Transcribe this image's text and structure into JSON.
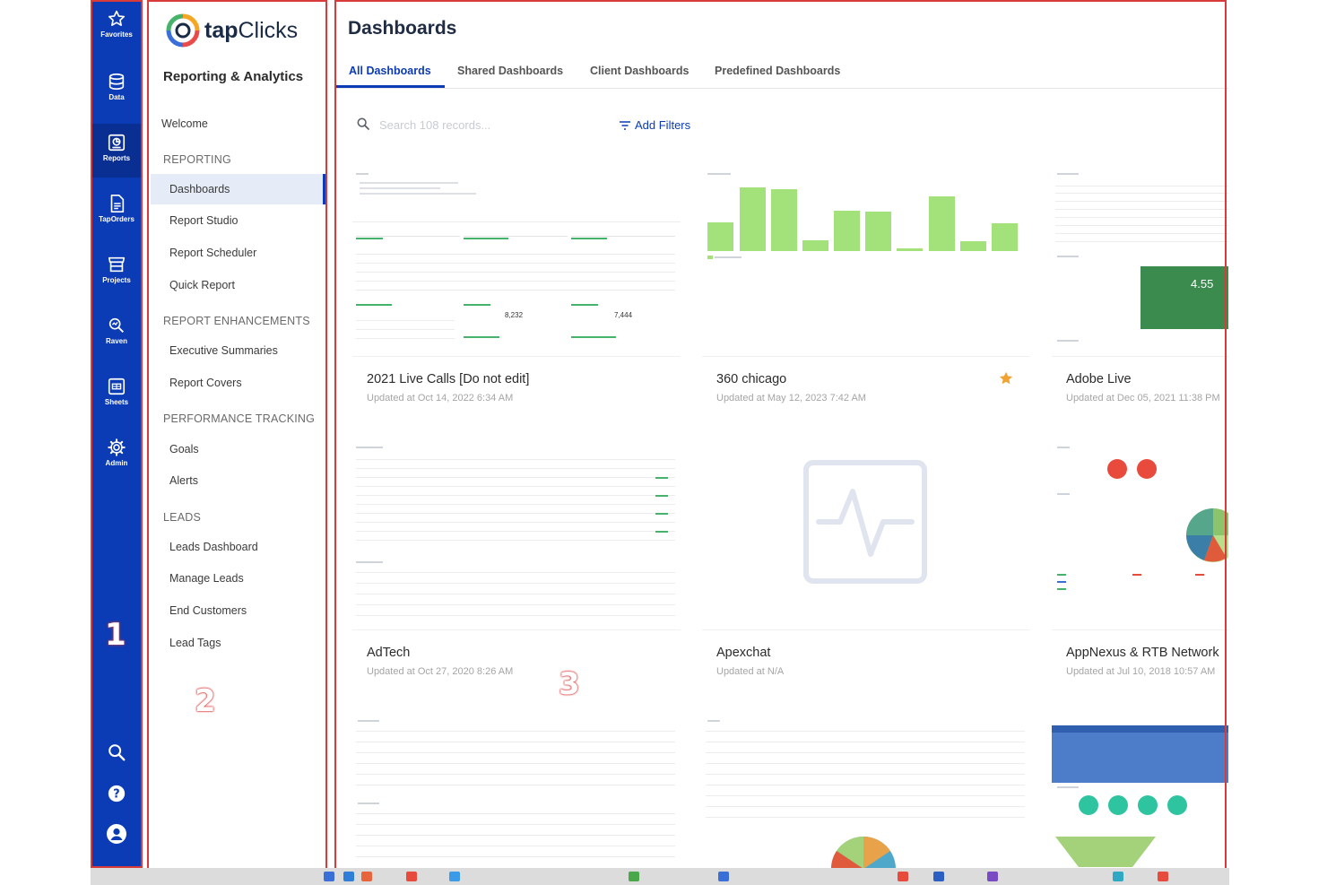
{
  "rail": {
    "items": [
      {
        "label": "Favorites",
        "icon": "star-outline-icon"
      },
      {
        "label": "Data",
        "icon": "database-icon"
      },
      {
        "label": "Reports",
        "icon": "reports-icon"
      },
      {
        "label": "TapOrders",
        "icon": "document-icon"
      },
      {
        "label": "Projects",
        "icon": "store-icon"
      },
      {
        "label": "Raven",
        "icon": "raven-search-icon"
      },
      {
        "label": "Sheets",
        "icon": "sheet-icon"
      },
      {
        "label": "Admin",
        "icon": "gear-icon"
      }
    ],
    "active": "Reports",
    "bottom_icons": [
      "search-icon",
      "help-icon",
      "user-icon"
    ]
  },
  "annotations": [
    "1",
    "2",
    "3"
  ],
  "logo": {
    "part1": "tap",
    "part2": "Clicks"
  },
  "sidenav": {
    "title": "Reporting & Analytics",
    "welcome": "Welcome",
    "reporting": "REPORTING",
    "dashboards": "Dashboards",
    "report_studio": "Report Studio",
    "report_scheduler": "Report Scheduler",
    "quick_report": "Quick Report",
    "report_enhancements": "REPORT ENHANCEMENTS",
    "executive_summaries": "Executive Summaries",
    "report_covers": "Report Covers",
    "performance_tracking": "PERFORMANCE TRACKING",
    "goals": "Goals",
    "alerts": "Alerts",
    "leads": "LEADS",
    "leads_dashboard": "Leads Dashboard",
    "manage_leads": "Manage Leads",
    "end_customers": "End Customers",
    "lead_tags": "Lead Tags"
  },
  "main": {
    "title": "Dashboards",
    "tabs": [
      "All Dashboards",
      "Shared Dashboards",
      "Client Dashboards",
      "Predefined Dashboards"
    ],
    "active_tab": "All Dashboards",
    "search_placeholder": "Search 108 records...",
    "add_filters": "Add Filters"
  },
  "cards": [
    {
      "title": "2021 Live Calls [Do not edit]",
      "updated": "Updated at Oct 14, 2022 6:34 AM",
      "metrics": [
        "8,232",
        "7,444"
      ],
      "favorite": false
    },
    {
      "title": "360 chicago",
      "updated": "Updated at May 12, 2023 7:42 AM",
      "favorite": true
    },
    {
      "title": "Adobe Live",
      "updated": "Updated at Dec 05, 2021 11:38 PM",
      "metrics": [
        "4.55"
      ],
      "favorite": false
    },
    {
      "title": "AdTech",
      "updated": "Updated at Oct 27, 2020 8:26 AM",
      "favorite": false
    },
    {
      "title": "Apexchat",
      "updated": "Updated at N/A",
      "favorite": false
    },
    {
      "title": "AppNexus & RTB Network",
      "updated": "Updated at Jul 10, 2018 10:57 AM",
      "favorite": false
    }
  ],
  "colors": {
    "brand": "#0b3bb5",
    "annotation": "#d93a3a",
    "bar": "#a3e27a",
    "star": "#f0a232"
  }
}
